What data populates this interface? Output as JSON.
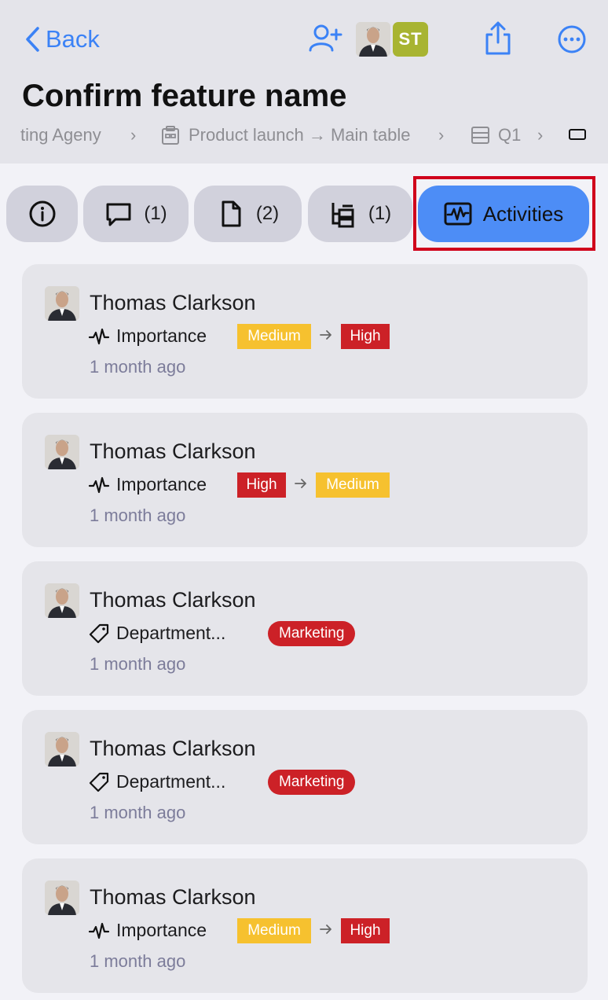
{
  "header": {
    "back_label": "Back",
    "initials": "ST",
    "title": "Confirm feature name",
    "breadcrumb": {
      "first": "ting Ageny",
      "board": "Product launch → Main table",
      "group": "Q1"
    }
  },
  "tabs": [
    {
      "icon": "info-icon",
      "label": ""
    },
    {
      "icon": "comment-icon",
      "label": "(1)"
    },
    {
      "icon": "file-icon",
      "label": "(2)"
    },
    {
      "icon": "subitems-icon",
      "label": "(1)"
    },
    {
      "icon": "activity-icon",
      "label": "Activities",
      "active": true
    }
  ],
  "activities": [
    {
      "user": "Thomas Clarkson",
      "field": "Importance",
      "field_icon": "pulse-icon",
      "from": "Medium",
      "to": "High",
      "time": "1 month ago"
    },
    {
      "user": "Thomas Clarkson",
      "field": "Importance",
      "field_icon": "pulse-icon",
      "from": "High",
      "to": "Medium",
      "time": "1 month ago"
    },
    {
      "user": "Thomas Clarkson",
      "field": "Department...",
      "field_icon": "tag-icon",
      "value": "Marketing",
      "time": "1 month ago"
    },
    {
      "user": "Thomas Clarkson",
      "field": "Department...",
      "field_icon": "tag-icon",
      "value": "Marketing",
      "time": "1 month ago"
    },
    {
      "user": "Thomas Clarkson",
      "field": "Importance",
      "field_icon": "pulse-icon",
      "from": "Medium",
      "to": "High",
      "time": "1 month ago"
    }
  ],
  "colors": {
    "accent": "#3b82f6",
    "active_tab": "#4d8df6",
    "medium": "#f6c12f",
    "high": "#cc2127",
    "marketing": "#cc2127",
    "highlight_box": "#d0021b"
  }
}
